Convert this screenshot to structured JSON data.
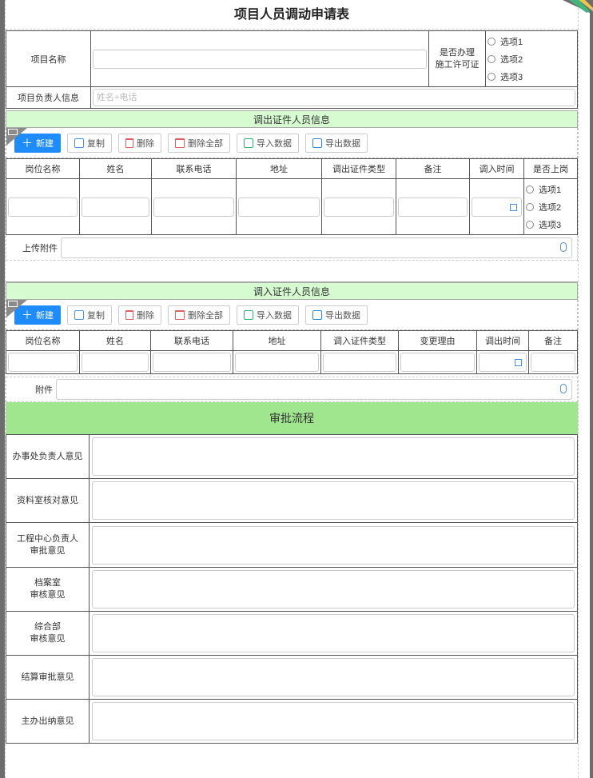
{
  "title": "项目人员调动申请表",
  "project": {
    "name_label": "项目名称",
    "permit_label_line1": "是否办理",
    "permit_label_line2": "施工许可证",
    "permit_options": [
      "选项1",
      "选项2",
      "选项3"
    ],
    "leader_label": "项目负责人信息",
    "leader_placeholder": "姓名+电话"
  },
  "toolbar": {
    "new": "新建",
    "copy": "复制",
    "delete": "删除",
    "delete_all": "删除全部",
    "import": "导入数据",
    "export": "导出数据"
  },
  "out_section": {
    "title": "调出证件人员信息",
    "columns": [
      "岗位名称",
      "姓名",
      "联系电话",
      "地址",
      "调出证件类型",
      "备注",
      "调入时间",
      "是否上岗"
    ],
    "onduty_options": [
      "选项1",
      "选项2",
      "选项3"
    ],
    "upload_label": "上传附件"
  },
  "in_section": {
    "title": "调入证件人员信息",
    "columns": [
      "岗位名称",
      "姓名",
      "联系电话",
      "地址",
      "调入证件类型",
      "变更理由",
      "调出时间",
      "备注"
    ],
    "attachment_label": "附件"
  },
  "approval": {
    "title": "审批流程",
    "rows": [
      {
        "line1": "办事处负责人意见",
        "line2": ""
      },
      {
        "line1": "资料室核对意见",
        "line2": ""
      },
      {
        "line1": "工程中心负责人",
        "line2": "审批意见"
      },
      {
        "line1": "档案室",
        "line2": "审核意见"
      },
      {
        "line1": "综合部",
        "line2": "审核意见"
      },
      {
        "line1": "结算审批意见",
        "line2": ""
      },
      {
        "line1": "主办出纳意见",
        "line2": ""
      }
    ]
  },
  "colors": {
    "section_header": "#d6fbd0",
    "approval_header": "#9fe68f",
    "primary_button": "#1e8cff"
  }
}
